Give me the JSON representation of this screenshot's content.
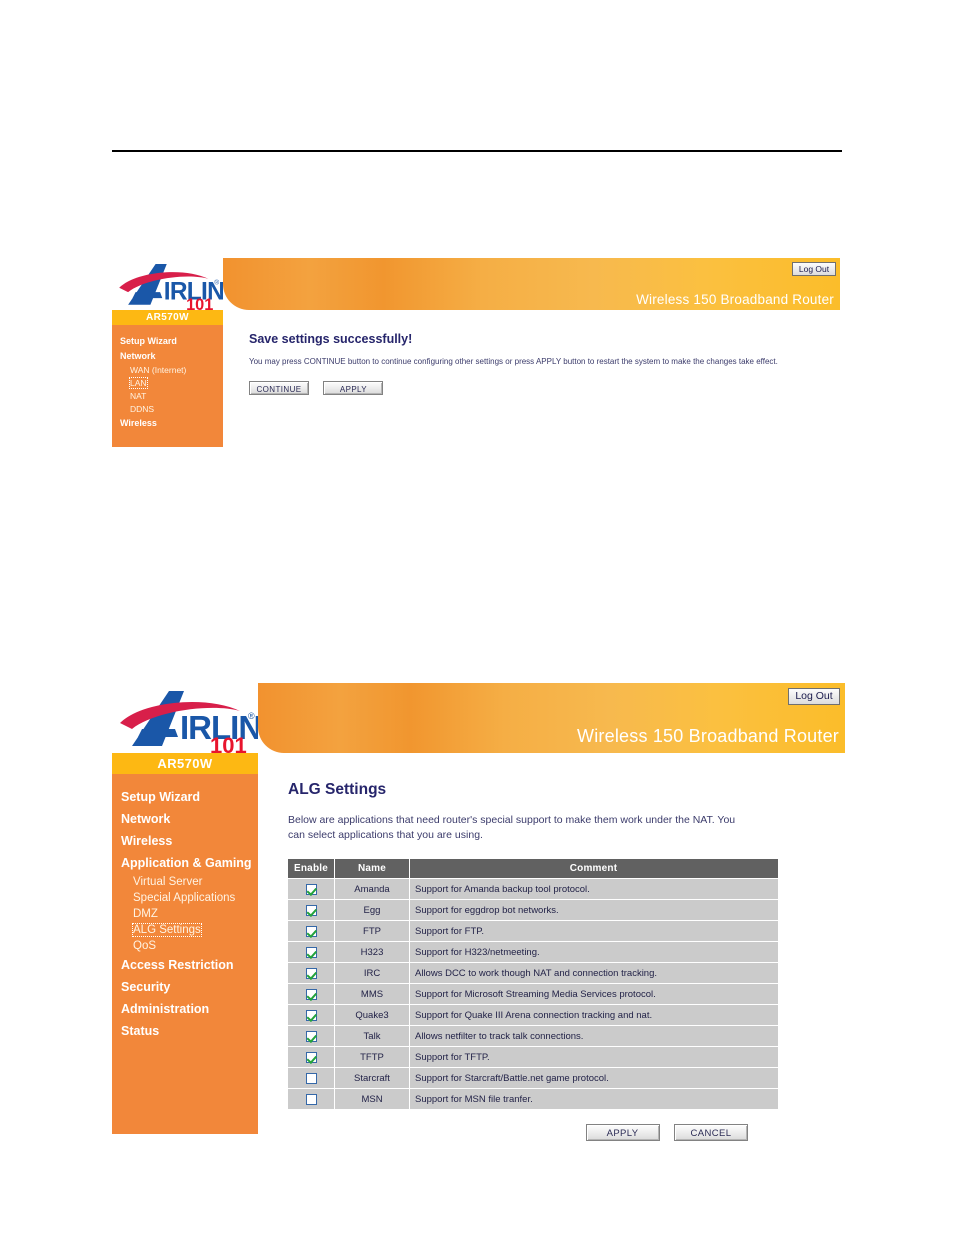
{
  "brand": {
    "logo_text_a": "A",
    "logo_text_main": "IRLINK",
    "logo_text_101": "101",
    "logo_reg": "®"
  },
  "shot1": {
    "model": "AR570W",
    "header_title": "Wireless 150 Broadband Router",
    "logout_label": "Log Out",
    "page_title": "Save settings successfully!",
    "body_text": "You may press CONTINUE button to continue configuring other settings or press APPLY button to restart the system to make the changes take effect.",
    "buttons": {
      "continue": "CONTINUE",
      "apply": "APPLY"
    },
    "nav": [
      {
        "label": "Setup Wizard",
        "level": "top",
        "focused": false
      },
      {
        "label": "Network",
        "level": "top",
        "focused": false
      },
      {
        "label": "WAN (Internet)",
        "level": "sub",
        "focused": false
      },
      {
        "label": "LAN",
        "level": "sub",
        "focused": true
      },
      {
        "label": "NAT",
        "level": "sub",
        "focused": false
      },
      {
        "label": "DDNS",
        "level": "sub",
        "focused": false
      },
      {
        "label": "Wireless",
        "level": "top",
        "focused": false
      }
    ]
  },
  "shot2": {
    "model": "AR570W",
    "header_title": "Wireless 150 Broadband Router",
    "logout_label": "Log Out",
    "page_title": "ALG Settings",
    "body_text": "Below are applications that need router's special support to make them work under the NAT. You can select applications that you are using.",
    "buttons": {
      "apply": "APPLY",
      "cancel": "CANCEL"
    },
    "nav": [
      {
        "label": "Setup Wizard",
        "level": "top",
        "focused": false
      },
      {
        "label": "Network",
        "level": "top",
        "focused": false
      },
      {
        "label": "Wireless",
        "level": "top",
        "focused": false
      },
      {
        "label": "Application & Gaming",
        "level": "top",
        "focused": false
      },
      {
        "label": "Virtual Server",
        "level": "sub",
        "focused": false
      },
      {
        "label": "Special Applications",
        "level": "sub",
        "focused": false
      },
      {
        "label": "DMZ",
        "level": "sub",
        "focused": false
      },
      {
        "label": "ALG Settings",
        "level": "sub",
        "focused": true
      },
      {
        "label": "QoS",
        "level": "sub",
        "focused": false
      },
      {
        "label": "Access Restriction",
        "level": "top",
        "focused": false
      },
      {
        "label": "Security",
        "level": "top",
        "focused": false
      },
      {
        "label": "Administration",
        "level": "top",
        "focused": false
      },
      {
        "label": "Status",
        "level": "top",
        "focused": false
      }
    ],
    "table": {
      "headers": [
        "Enable",
        "Name",
        "Comment"
      ],
      "rows": [
        {
          "enabled": true,
          "name": "Amanda",
          "comment": "Support for Amanda backup tool protocol."
        },
        {
          "enabled": true,
          "name": "Egg",
          "comment": "Support for eggdrop bot networks."
        },
        {
          "enabled": true,
          "name": "FTP",
          "comment": "Support for FTP."
        },
        {
          "enabled": true,
          "name": "H323",
          "comment": "Support for H323/netmeeting."
        },
        {
          "enabled": true,
          "name": "IRC",
          "comment": "Allows DCC to work though NAT and connection tracking."
        },
        {
          "enabled": true,
          "name": "MMS",
          "comment": "Support for Microsoft Streaming Media Services protocol."
        },
        {
          "enabled": true,
          "name": "Quake3",
          "comment": "Support for Quake III Arena connection tracking and nat."
        },
        {
          "enabled": true,
          "name": "Talk",
          "comment": "Allows netfilter to track talk connections."
        },
        {
          "enabled": true,
          "name": "TFTP",
          "comment": "Support for TFTP."
        },
        {
          "enabled": false,
          "name": "Starcraft",
          "comment": "Support for Starcraft/Battle.net game protocol."
        },
        {
          "enabled": false,
          "name": "MSN",
          "comment": "Support for MSN file tranfer."
        }
      ]
    }
  },
  "colors": {
    "sidebar_orange": "#f2873a",
    "model_band_yellow": "#fdb813",
    "header_gradient_left": "#f2922f",
    "header_gradient_right": "#fbbd2a",
    "title_navy": "#26256b",
    "table_header_gray": "#616161",
    "table_cell_gray": "#cbcbcb"
  }
}
